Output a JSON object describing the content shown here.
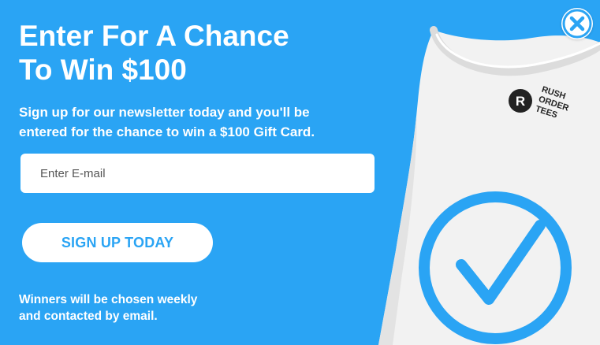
{
  "popup": {
    "headline_line1": "Enter For A Chance",
    "headline_line2": "To Win $100",
    "subtext_line1": "Sign up for our newsletter today and you'll be",
    "subtext_line2": "entered for the chance to win a $100 Gift Card.",
    "email_placeholder": "Enter E-mail",
    "email_value": "",
    "signup_label": "SIGN UP TODAY",
    "footer_line1": "Winners will be chosen weekly",
    "footer_line2": "and contacted by email."
  },
  "brand": {
    "logo_letter": "R",
    "logo_line1": "RUSH",
    "logo_line2": "ORDER",
    "logo_line3": "TEES"
  },
  "icons": {
    "close": "close-icon",
    "checkmark": "checkmark-icon"
  },
  "colors": {
    "background": "#2aa4f4",
    "accent": "#2aa4f4",
    "shirt": "#f2f2f2",
    "text_light": "#ffffff"
  }
}
